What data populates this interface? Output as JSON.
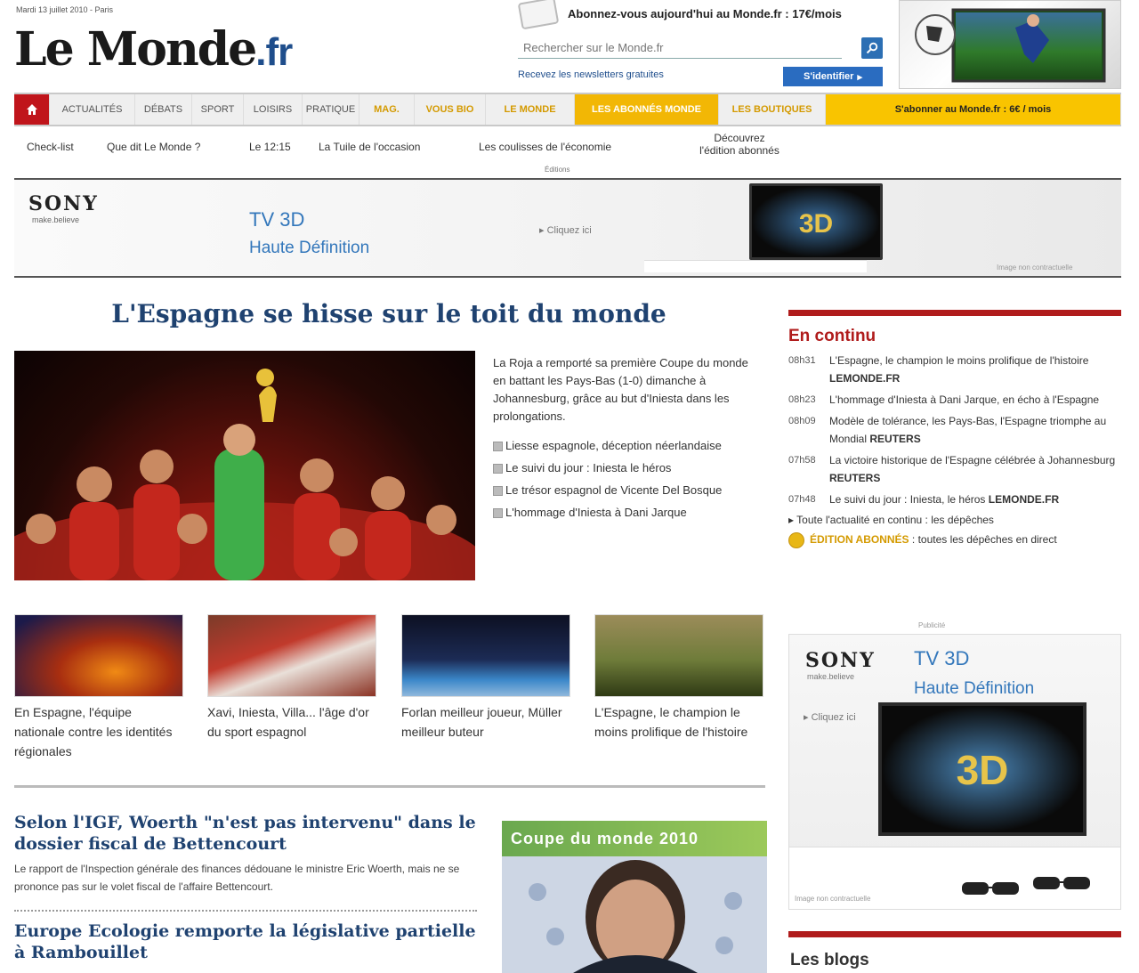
{
  "header": {
    "date_line": "Mardi 13 juillet 2010 - Paris",
    "logo_main": "Le Monde",
    "logo_tld": ".fr",
    "subscribe_promo": "Abonnez-vous aujourd'hui au Monde.fr : 17€/mois",
    "search_placeholder": "Rechercher sur le Monde.fr",
    "newsletter_link": "Recevez les newsletters gratuites",
    "identify_label": "S'identifier",
    "identify_arrow": "▸"
  },
  "nav": {
    "items": [
      "Actualités",
      "Débats",
      "Sport",
      "Loisirs",
      "Pratique"
    ],
    "gold_items": [
      "Mag.",
      "Vous Bio",
      "Le Monde"
    ],
    "highlight_item": "Les abonnés Monde",
    "jobs_item": "Les Boutiques",
    "subscribe_item": "S'abonner au Monde.fr : 6€ / mois"
  },
  "subnav": {
    "links": [
      "Check-list",
      "Que dit Le Monde ?",
      "Le 12:15",
      "La Tuile de l'occasion",
      "Les coulisses de l'économie"
    ],
    "edition_line1": "Découvrez",
    "edition_line2": "l'édition abonnés",
    "note": "Éditions"
  },
  "banner_ad": {
    "brand": "SONY",
    "tagline": "make.believe",
    "line1": "TV 3D",
    "line2": "Haute Définition",
    "cta": "▸ Cliquez ici",
    "tv_label": "3D",
    "fine_print": "Image non contractuelle"
  },
  "lead": {
    "headline": "L'Espagne se hisse sur le toit du monde",
    "text": "La Roja a remporté sa première Coupe du monde en battant les Pays-Bas (1-0) dimanche à Johannesburg, grâce au but d'Iniesta dans les prolongations.",
    "bullets": [
      "Liesse espagnole, déception néerlandaise",
      "Le suivi du jour : Iniesta le héros",
      "Le trésor espagnol de Vicente Del Bosque",
      "L'hommage d'Iniesta à Dani Jarque"
    ]
  },
  "thumbs": [
    {
      "caption": "En Espagne, l'équipe nationale contre les identités régionales"
    },
    {
      "caption": "Xavi, Iniesta, Villa... l'âge d'or du sport espagnol"
    },
    {
      "caption": "Forlan meilleur joueur, Müller meilleur buteur"
    },
    {
      "caption": "L'Espagne, le champion le moins prolifique de l'histoire"
    }
  ],
  "stories": [
    {
      "title": "Selon l'IGF, Woerth \"n'est pas intervenu\" dans le dossier fiscal de Bettencourt",
      "summary": "Le rapport de l'Inspection générale des finances dédouane le ministre Eric Woerth, mais ne se prononce pas sur le volet fiscal de l'affaire Bettencourt."
    },
    {
      "title": "Europe Ecologie remporte la législative partielle à Rambouillet"
    }
  ],
  "promo_box": {
    "label": "Coupe du monde 2010"
  },
  "sidebar": {
    "title": "En continu",
    "news": [
      {
        "time": "08h31",
        "text": "L'Espagne, le champion le moins prolifique de l'histoire",
        "source": "LEMONDE.FR"
      },
      {
        "time": "08h23",
        "text": "L'hommage d'Iniesta à Dani Jarque, en écho à l'Espagne",
        "source": ""
      },
      {
        "time": "08h09",
        "text": "Modèle de tolérance, les Pays-Bas, l'Espagne triomphe au Mondial",
        "source": "REUTERS"
      },
      {
        "time": "07h58",
        "text": "La victoire historique de l'Espagne célébrée à Johannesburg",
        "source": "REUTERS"
      },
      {
        "time": "07h48",
        "text": "Le suivi du jour : Iniesta, le héros",
        "source": "LEMONDE.FR"
      }
    ],
    "all_dispatches": "▸ Toute l'actualité en continu : les dépêches",
    "edition_label": "ÉDITION ABONNÉS",
    "edition_text": " : toutes les dépêches en direct",
    "pub_label": "Publicité",
    "blogs_title": "Les blogs"
  },
  "side_ad": {
    "brand": "SONY",
    "tagline": "make.believe",
    "line1": "TV 3D",
    "line2": "Haute Définition",
    "cta": "▸ Cliquez ici",
    "tv_label": "3D",
    "fine_print": "Image non contractuelle"
  },
  "colors": {
    "accent_red": "#b01c1c",
    "nav_gold": "#f2b705",
    "link_blue": "#1f4270"
  }
}
